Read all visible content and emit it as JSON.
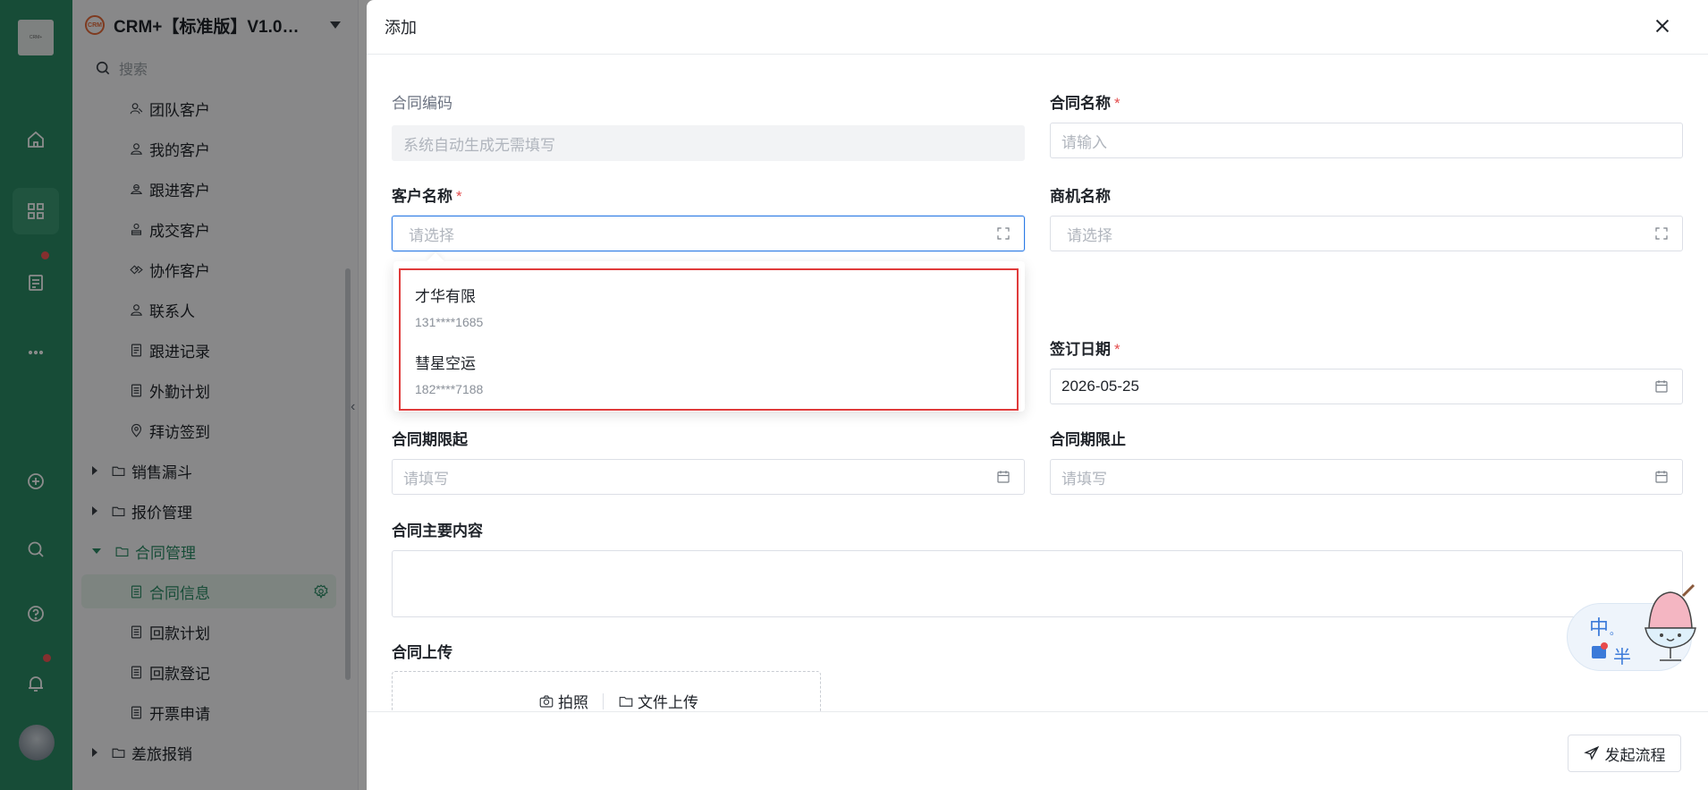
{
  "app": {
    "title": "CRM+【标准版】V1.0…",
    "search_placeholder": "搜索"
  },
  "rail": {
    "logo_text": "CRM+"
  },
  "sidebar": {
    "items": [
      {
        "label": "团队客户",
        "icon": "team-customer-icon"
      },
      {
        "label": "我的客户",
        "icon": "user-icon"
      },
      {
        "label": "跟进客户",
        "icon": "follow-customer-icon"
      },
      {
        "label": "成交客户",
        "icon": "deal-customer-icon"
      },
      {
        "label": "协作客户",
        "icon": "handshake-icon"
      },
      {
        "label": "联系人",
        "icon": "contact-icon"
      },
      {
        "label": "跟进记录",
        "icon": "record-icon"
      },
      {
        "label": "外勤计划",
        "icon": "plan-icon"
      },
      {
        "label": "拜访签到",
        "icon": "location-icon"
      },
      {
        "label": "销售漏斗",
        "icon": "folder-icon"
      },
      {
        "label": "报价管理",
        "icon": "folder-icon"
      },
      {
        "label": "合同管理",
        "icon": "folder-icon"
      },
      {
        "label": "合同信息",
        "icon": "document-icon"
      },
      {
        "label": "回款计划",
        "icon": "document-icon"
      },
      {
        "label": "回款登记",
        "icon": "document-icon"
      },
      {
        "label": "开票申请",
        "icon": "document-icon"
      },
      {
        "label": "差旅报销",
        "icon": "folder-icon"
      }
    ]
  },
  "drawer": {
    "title": "添加",
    "fields": {
      "contract_code": {
        "label": "合同编码",
        "placeholder": "系统自动生成无需填写"
      },
      "contract_name": {
        "label": "合同名称",
        "placeholder": "请输入"
      },
      "customer_name": {
        "label": "客户名称",
        "placeholder": "请选择"
      },
      "opportunity_name": {
        "label": "商机名称",
        "placeholder": "请选择"
      },
      "sign_date": {
        "label": "签订日期",
        "value": "2026-05-25"
      },
      "period_start": {
        "label": "合同期限起",
        "placeholder": "请填写"
      },
      "period_end": {
        "label": "合同期限止",
        "placeholder": "请填写"
      },
      "main_content": {
        "label": "合同主要内容"
      },
      "upload": {
        "label": "合同上传",
        "photo": "拍照",
        "file": "文件上传"
      }
    },
    "required_mark": "*",
    "dropdown": [
      {
        "name": "才华有限",
        "phone": "131****1685"
      },
      {
        "name": "彗星空运",
        "phone": "182****7188"
      }
    ],
    "submit_label": "发起流程"
  },
  "mascot": {
    "char1": "中",
    "char2": "。",
    "char3": "半"
  },
  "colors": {
    "brand": "#2b8a64",
    "required": "#e34d4d",
    "focus": "#2c7be5",
    "highlight": "#e03b3b"
  }
}
